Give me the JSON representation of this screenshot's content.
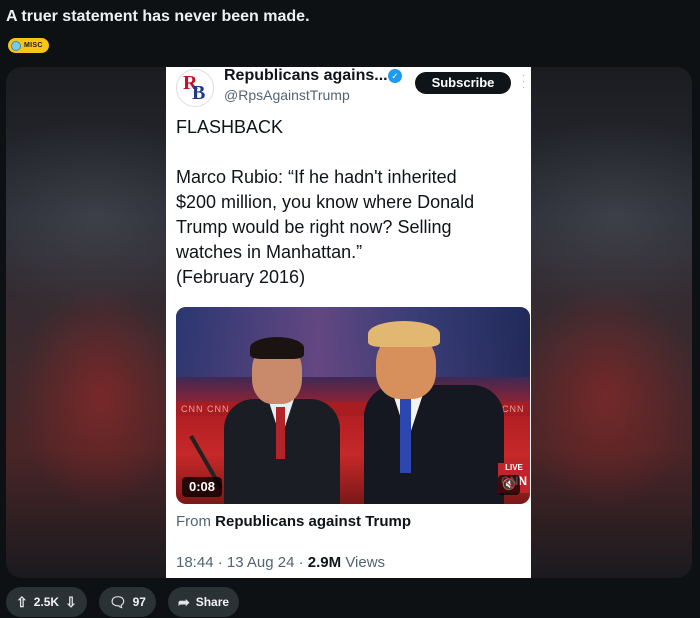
{
  "post": {
    "title": "A truer statement has never been made.",
    "flair": "MISC"
  },
  "tweet": {
    "account_name": "Republicans agains...",
    "handle": "@RpsAgainstTrump",
    "subscribe_label": "Subscribe",
    "lines": [
      "FLASHBACK",
      "Marco Rubio: “If he hadn't inherited",
      "$200 million, you know where Donald",
      "Trump would be right now? Selling",
      "watches in Manhattan.”",
      "(February 2016)"
    ],
    "video": {
      "duration": "0:08",
      "live_label": "LIVE",
      "network": "CNN",
      "banner_left": "CNN CNN C",
      "banner_right": "CNN CNN C"
    },
    "from_prefix": "From",
    "from_source": "Republicans against Trump",
    "time_date": "18:44 · 13 Aug 24 ·",
    "views_count": "2.9M",
    "views_label": "Views"
  },
  "actions": {
    "votes": "2.5K",
    "comments": "97",
    "share_label": "Share"
  },
  "icons": {
    "upvote": "arrow-up-icon",
    "downvote": "arrow-down-icon",
    "comment": "comment-icon",
    "share": "share-icon",
    "verified": "verified-badge-icon"
  },
  "colors": {
    "background": "#0e1113",
    "flair_bg": "#f5c518",
    "pill_bg": "#2a3236",
    "verified": "#1d9bf0"
  }
}
